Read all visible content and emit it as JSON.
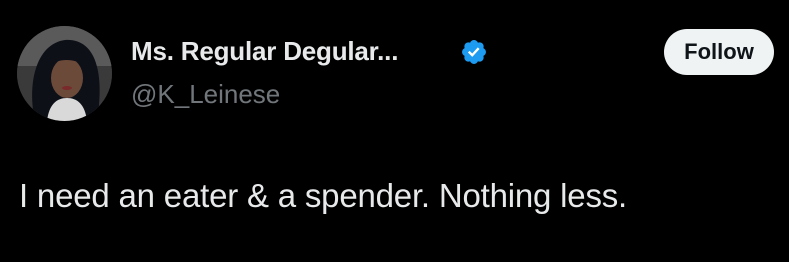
{
  "user": {
    "display_name": "Ms. Regular Degular...",
    "handle": "@K_Leinese",
    "verified": true,
    "avatar_icon": "profile-photo"
  },
  "actions": {
    "follow_label": "Follow"
  },
  "tweet": {
    "text": "I need an eater & a spender. Nothing less."
  },
  "colors": {
    "background": "#000000",
    "primary_text": "#e7e9ea",
    "secondary_text": "#71767b",
    "verified_blue": "#1d9bf0",
    "follow_button_bg": "#eff3f4",
    "follow_button_text": "#0f1419"
  }
}
